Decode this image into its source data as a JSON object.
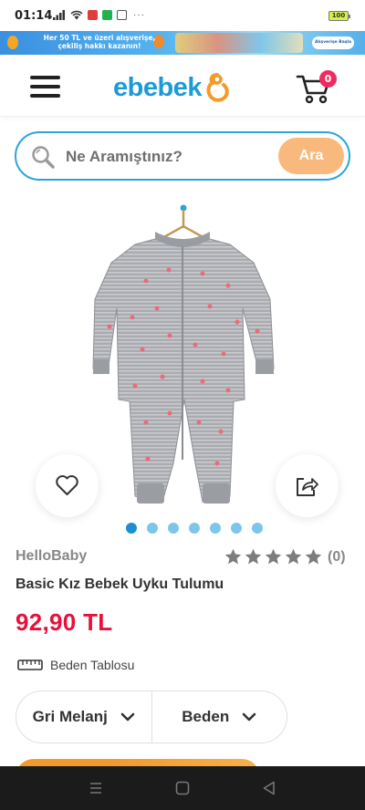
{
  "status": {
    "time": "01:14",
    "battery": "100",
    "more": "···"
  },
  "promo": {
    "text": "Her 50 TL ve üzeri alışverişe, çekiliş hakkı kazanın!",
    "button": "Alışverişe Başla"
  },
  "header": {
    "logo_text": "ebebek",
    "cart_count": "0"
  },
  "search": {
    "placeholder": "Ne Aramıştınız?",
    "button_label": "Ara"
  },
  "gallery": {
    "image_count": 7,
    "active_index": 0
  },
  "product": {
    "brand": "HelloBaby",
    "review_count": "(0)",
    "rating": 0,
    "max_rating": 5,
    "title": "Basic Kız Bebek Uyku Tulumu",
    "price": "92,90 TL",
    "size_chart_label": "Beden Tablosu",
    "color_select": "Gri Melanj",
    "size_select": "Beden"
  },
  "colors": {
    "brand_blue": "#1a9bd8",
    "accent_orange": "#f9b97c",
    "price_red": "#e8103b",
    "badge_pink": "#ee2b5f",
    "dot_active": "#1d8fd0",
    "dot_inactive": "#7cc6ea",
    "button_orange": "#f39a2d"
  }
}
